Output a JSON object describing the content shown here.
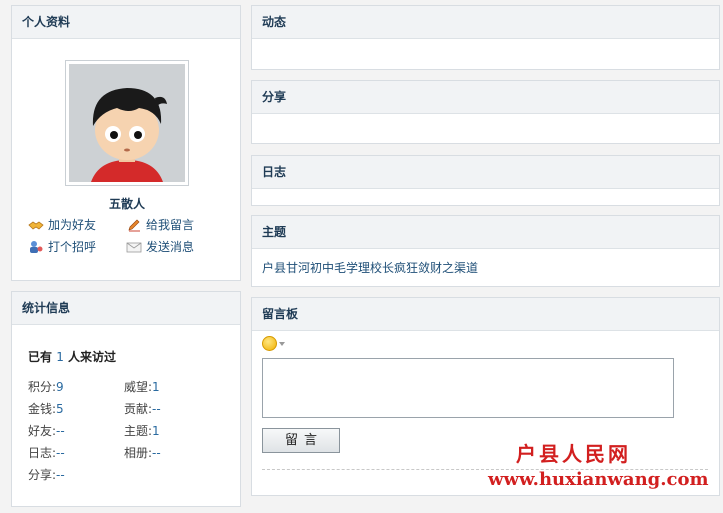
{
  "profile": {
    "title": "个人资料",
    "name": "五散人",
    "actions": {
      "add_friend": "加为好友",
      "leave_message": "给我留言",
      "say_hi": "打个招呼",
      "send_message": "发送消息"
    }
  },
  "stats": {
    "title": "统计信息",
    "visits_prefix": "已有",
    "visits_count": "1",
    "visits_suffix": "人来访过",
    "items": [
      {
        "label": "积分:",
        "value": "9"
      },
      {
        "label": "威望:",
        "value": "1"
      },
      {
        "label": "金钱:",
        "value": "5"
      },
      {
        "label": "贡献:",
        "value": "--"
      },
      {
        "label": "好友:",
        "value": "--"
      },
      {
        "label": "主题:",
        "value": "1"
      },
      {
        "label": "日志:",
        "value": "--"
      },
      {
        "label": "相册:",
        "value": "--"
      },
      {
        "label": "分享:",
        "value": "--"
      }
    ]
  },
  "panels": {
    "activity": "动态",
    "share": "分享",
    "blog": "日志",
    "topic": "主题",
    "guestbook": "留言板"
  },
  "topic": {
    "item": "户县甘河初中毛学理校长疯狂敛财之渠道"
  },
  "guestbook": {
    "submit_label": "留言"
  },
  "watermark": {
    "cn": "户县人民网",
    "url": "www.huxianwang.com"
  },
  "colors": {
    "link": "#1f4f77",
    "watermark": "#d21f1f"
  }
}
